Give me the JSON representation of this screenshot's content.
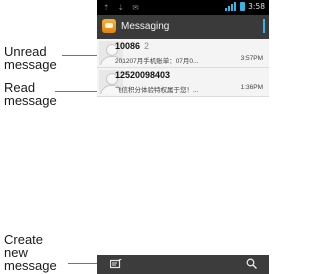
{
  "annotations": {
    "unread": "Unread\nmessage",
    "read": "Read\nmessage",
    "create": "Create\nnew\nmessage"
  },
  "status_bar": {
    "time": "3:58"
  },
  "action_bar": {
    "title": "Messaging"
  },
  "threads": [
    {
      "sender": "10086",
      "count": "2",
      "snippet": "201207月手机账单：07月0...",
      "time": "3:57PM",
      "unread": true
    },
    {
      "sender": "12520098403",
      "count": "",
      "snippet": "飞信积分体验特权属于您！...",
      "time": "1:36PM",
      "unread": false
    }
  ],
  "colors": {
    "accent": "#35b5e5",
    "pointer": "#3f7fc7",
    "action_bar": "#3a3a3a",
    "bottom_bar": "#3c3c3c"
  },
  "icons": {
    "compose": "compose-message-icon",
    "search": "search-icon",
    "app": "messaging-app-icon"
  }
}
